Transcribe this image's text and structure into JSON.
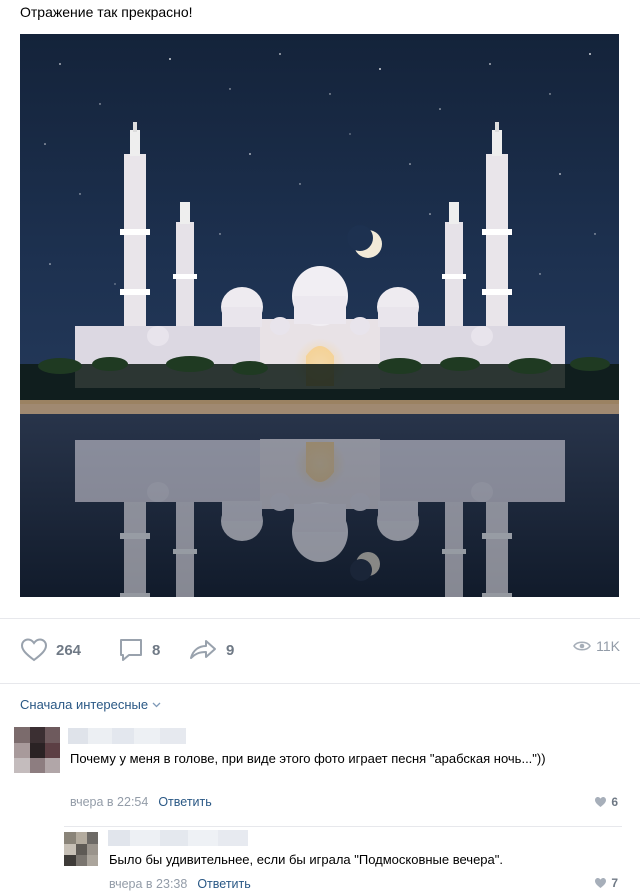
{
  "post": {
    "text": "Отражение так прекрасно!"
  },
  "photo": {
    "icon": "mosque-night-photo"
  },
  "actions": {
    "likes": "264",
    "comments": "8",
    "shares": "9",
    "views": "11K"
  },
  "comments_sort": {
    "label": "Сначала интересные"
  },
  "comments": [
    {
      "text": "Почему у меня в голове, при виде этого фото играет песня \"арабская ночь...\"))",
      "time": "вчера в 22:54",
      "reply": "Ответить",
      "likes": "6"
    },
    {
      "text": "Было бы удивительнее, если бы играла \"Подмосковные вечера\".",
      "time": "вчера в 23:38",
      "reply": "Ответить",
      "likes": "7"
    }
  ],
  "colors": {
    "link": "#2a5885",
    "muted": "#939ca8",
    "icon": "#99a2ad",
    "sky": "#1a2a44"
  }
}
